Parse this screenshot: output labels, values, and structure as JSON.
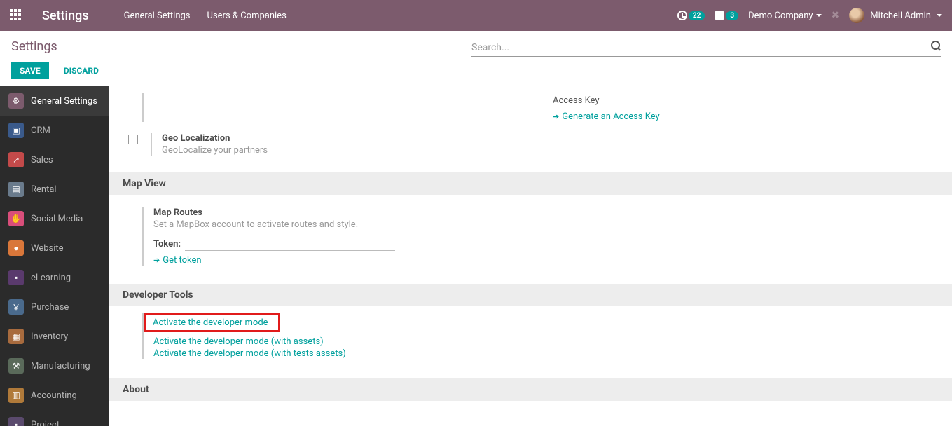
{
  "topnav": {
    "title": "Settings",
    "menu": [
      "General Settings",
      "Users & Companies"
    ],
    "clock_count": "22",
    "chat_count": "3",
    "company": "Demo Company",
    "user": "Mitchell Admin"
  },
  "breadcrumb": "Settings",
  "search_placeholder": "Search...",
  "buttons": {
    "save": "SAVE",
    "discard": "DISCARD"
  },
  "sidebar": [
    {
      "label": "General Settings",
      "color": "#7c5b6d",
      "glyph": "⚙",
      "active": true
    },
    {
      "label": "CRM",
      "color": "#3a5a8b",
      "glyph": "▣"
    },
    {
      "label": "Sales",
      "color": "#c34a4a",
      "glyph": "↗"
    },
    {
      "label": "Rental",
      "color": "#6a7b8c",
      "glyph": "▤"
    },
    {
      "label": "Social Media",
      "color": "#d94e7a",
      "glyph": "✋"
    },
    {
      "label": "Website",
      "color": "#d9773a",
      "glyph": "●"
    },
    {
      "label": "eLearning",
      "color": "#5a3a6d",
      "glyph": "▪"
    },
    {
      "label": "Purchase",
      "color": "#4a6a8c",
      "glyph": "￥"
    },
    {
      "label": "Inventory",
      "color": "#a86b3e",
      "glyph": "▦"
    },
    {
      "label": "Manufacturing",
      "color": "#5a6a5a",
      "glyph": "⚒"
    },
    {
      "label": "Accounting",
      "color": "#b07a3a",
      "glyph": "▥"
    },
    {
      "label": "Project",
      "color": "#5a4a6d",
      "glyph": "▪"
    }
  ],
  "top_right": {
    "access_key_label": "Access Key",
    "generate_link": "Generate an Access Key"
  },
  "geo": {
    "title": "Geo Localization",
    "desc": "GeoLocalize your partners"
  },
  "map_section": "Map View",
  "map": {
    "title": "Map Routes",
    "desc": "Set a MapBox account to activate routes and style.",
    "token_label": "Token:",
    "get_token": "Get token"
  },
  "dev_section": "Developer Tools",
  "dev": {
    "activate": "Activate the developer mode",
    "activate_assets": "Activate the developer mode (with assets)",
    "activate_tests": "Activate the developer mode (with tests assets)"
  },
  "about_section": "About"
}
